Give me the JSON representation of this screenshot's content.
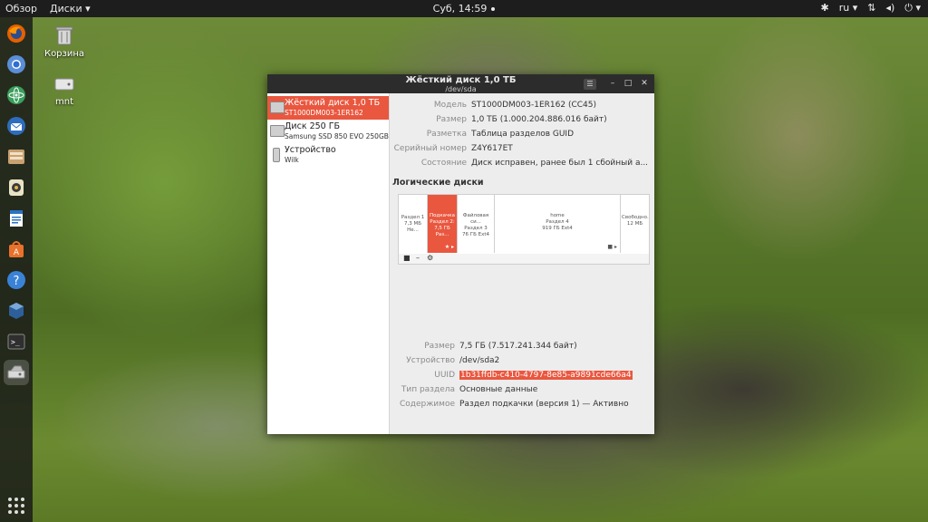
{
  "topbar": {
    "activities": "Обзор",
    "app_menu": "Диски ▾",
    "clock": "Суб, 14:59",
    "lang": "ru ▾",
    "icons": [
      "accessibility-icon",
      "lang-indicator",
      "network-icon",
      "volume-icon",
      "power-icon"
    ]
  },
  "dock": {
    "items": [
      "firefox",
      "chromium",
      "atom",
      "thunderbird",
      "files",
      "rhythmbox",
      "libreoffice-writer",
      "software-center",
      "help",
      "virtualbox",
      "terminal",
      "disks"
    ],
    "active": "disks"
  },
  "desktop": {
    "trash_label": "Корзина",
    "mnt_label": "mnt"
  },
  "window": {
    "title": "Жёсткий диск 1,0 ТБ",
    "subtitle": "/dev/sda",
    "menu_icon": "☰",
    "minimize": "–",
    "maximize": "□",
    "close": "✕"
  },
  "drives": [
    {
      "name": "Жёсткий диск 1,0 ТБ",
      "sub": "ST1000DM003-1ER162",
      "selected": true
    },
    {
      "name": "Диск 250 ГБ",
      "sub": "Samsung SSD 850 EVO 250GB",
      "selected": false
    },
    {
      "name": "Устройство",
      "sub": "Wilk",
      "selected": false
    }
  ],
  "disk_info": [
    {
      "key": "Модель",
      "value": "ST1000DM003-1ER162 (CC45)"
    },
    {
      "key": "Размер",
      "value": "1,0 ТБ (1.000.204.886.016 байт)"
    },
    {
      "key": "Разметка",
      "value": "Таблица разделов GUID"
    },
    {
      "key": "Серийный номер",
      "value": "Z4Y617ET"
    },
    {
      "key": "Состояние",
      "value": "Диск исправен, ранее был 1 сбойный а..."
    }
  ],
  "logical_title": "Логические диски",
  "partitions": [
    {
      "lines": [
        "Раздел 1",
        "7,3 МБ Не..."
      ],
      "selected": false
    },
    {
      "lines": [
        "Подкачка",
        "Раздел 2:",
        "7,5 ГБ Раз..."
      ],
      "selected": true,
      "marker": "★ ▸"
    },
    {
      "lines": [
        "Файловая си...",
        "Раздел 3",
        "76 ГБ Ext4"
      ],
      "selected": false
    },
    {
      "lines": [
        "home",
        "Раздел 4",
        "919 ГБ Ext4"
      ],
      "selected": false,
      "marker": "■ ▸"
    },
    {
      "lines": [
        "Свободно...",
        "12 МБ"
      ],
      "selected": false
    }
  ],
  "partition_toolbar": [
    "■",
    "–",
    "⚙"
  ],
  "partition_info": [
    {
      "key": "Размер",
      "value": "7,5 ГБ (7.517.241.344 байт)"
    },
    {
      "key": "Устройство",
      "value": "/dev/sda2"
    },
    {
      "key": "UUID",
      "value": "1b31ffdb-c410-4797-8e85-a9891cde66a4"
    },
    {
      "key": "Тип раздела",
      "value": "Основные данные"
    },
    {
      "key": "Содержимое",
      "value": "Раздел подкачки (версия 1) — Активно"
    }
  ],
  "colors": {
    "accent": "#e9573f",
    "topbar": "#1d1d1d",
    "titlebar": "#2c2c2c",
    "content_bg": "#ededed"
  }
}
